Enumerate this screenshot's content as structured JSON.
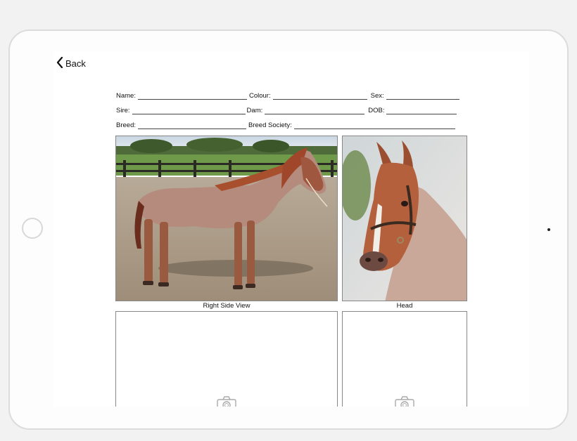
{
  "nav": {
    "back_label": "Back"
  },
  "form": {
    "name_label": "Name:",
    "colour_label": "Colour:",
    "sex_label": "Sex:",
    "sire_label": "Sire:",
    "dam_label": "Dam:",
    "dob_label": "DOB:",
    "breed_label": "Breed:",
    "breed_society_label": "Breed Society:"
  },
  "photos": {
    "right_side_caption": "Right Side View",
    "head_caption": "Head"
  },
  "icons": {
    "back": "chevron-left-icon",
    "camera": "camera-icon"
  },
  "colors": {
    "device_frame": "#dcdcdc",
    "line": "#444444",
    "border": "#888888"
  }
}
